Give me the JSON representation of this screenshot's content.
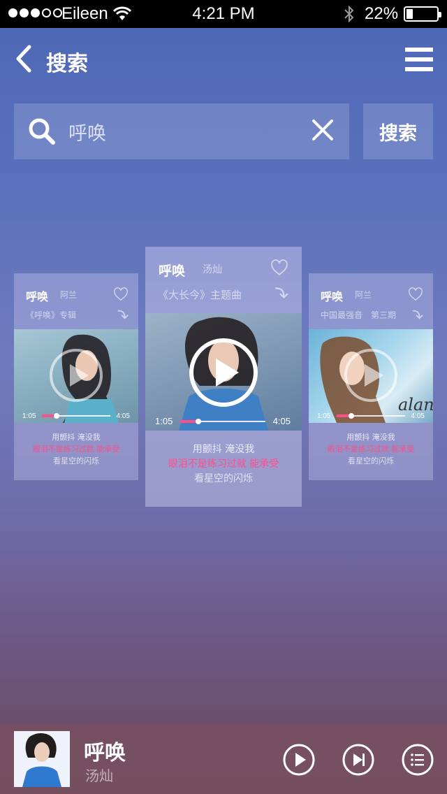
{
  "status_bar": {
    "carrier": "Eileen",
    "time": "4:21 PM",
    "battery": "22%"
  },
  "nav": {
    "title": "搜索"
  },
  "search": {
    "value": "呼唤",
    "button_label": "搜索"
  },
  "cards": [
    {
      "title": "呼唤",
      "artist": "阿兰",
      "subtitle": "《呼唤》专辑",
      "time_start": "1:05",
      "time_end": "4:05",
      "lyrics": [
        "用颤抖 淹没我",
        "眼泪不是练习过就 能承受",
        "看星空的闪烁"
      ]
    },
    {
      "title": "呼唤",
      "artist": "汤灿",
      "subtitle": "《大长今》主题曲",
      "time_start": "1:05",
      "time_end": "4:05",
      "lyrics": [
        "用颤抖 淹没我",
        "眼泪不是练习过就 能承受",
        "看星空的闪烁"
      ]
    },
    {
      "title": "呼唤",
      "artist": "阿兰",
      "subtitle": "中国最强音　第三期",
      "time_start": "1:05",
      "time_end": "4:05",
      "lyrics": [
        "用颤抖 淹没我",
        "眼泪不是练习过就 能承受",
        "看星空的闪烁"
      ],
      "cover_text": "alan"
    }
  ],
  "player": {
    "title": "呼唤",
    "artist": "汤灿"
  },
  "colors": {
    "accent": "#ff4e8a",
    "top": "#4d67b5",
    "bottom": "#6b4a5f"
  },
  "icons": [
    "back-icon",
    "menu-icon",
    "search-icon",
    "clear-icon",
    "heart-icon",
    "share-arrow-icon",
    "play-icon",
    "next-icon",
    "playlist-icon"
  ]
}
